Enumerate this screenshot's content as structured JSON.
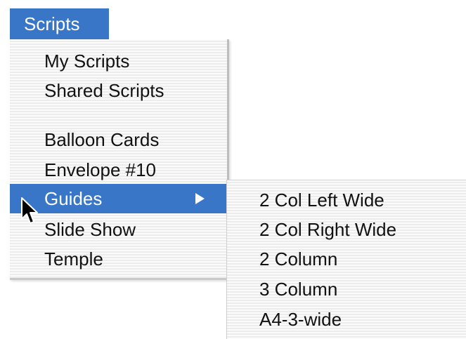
{
  "menu_bar": {
    "title": "Scripts"
  },
  "scripts_menu": {
    "items": [
      {
        "label": "My Scripts"
      },
      {
        "label": "Shared Scripts"
      },
      {
        "label": "Balloon Cards"
      },
      {
        "label": "Envelope #10"
      },
      {
        "label": "Guides",
        "highlighted": true,
        "has_submenu": true
      },
      {
        "label": "Slide Show"
      },
      {
        "label": "Temple"
      }
    ]
  },
  "guides_submenu": {
    "items": [
      {
        "label": "2 Col Left Wide"
      },
      {
        "label": "2 Col Right Wide"
      },
      {
        "label": "2 Column"
      },
      {
        "label": "3 Column"
      },
      {
        "label": "A4-3-wide"
      }
    ]
  },
  "colors": {
    "highlight": "#3976c8",
    "highlight_text": "#ffffff",
    "menu_text": "#111111"
  },
  "icons": {
    "submenu_indicator": "triangle-right-icon",
    "cursor": "mouse-pointer-icon"
  }
}
